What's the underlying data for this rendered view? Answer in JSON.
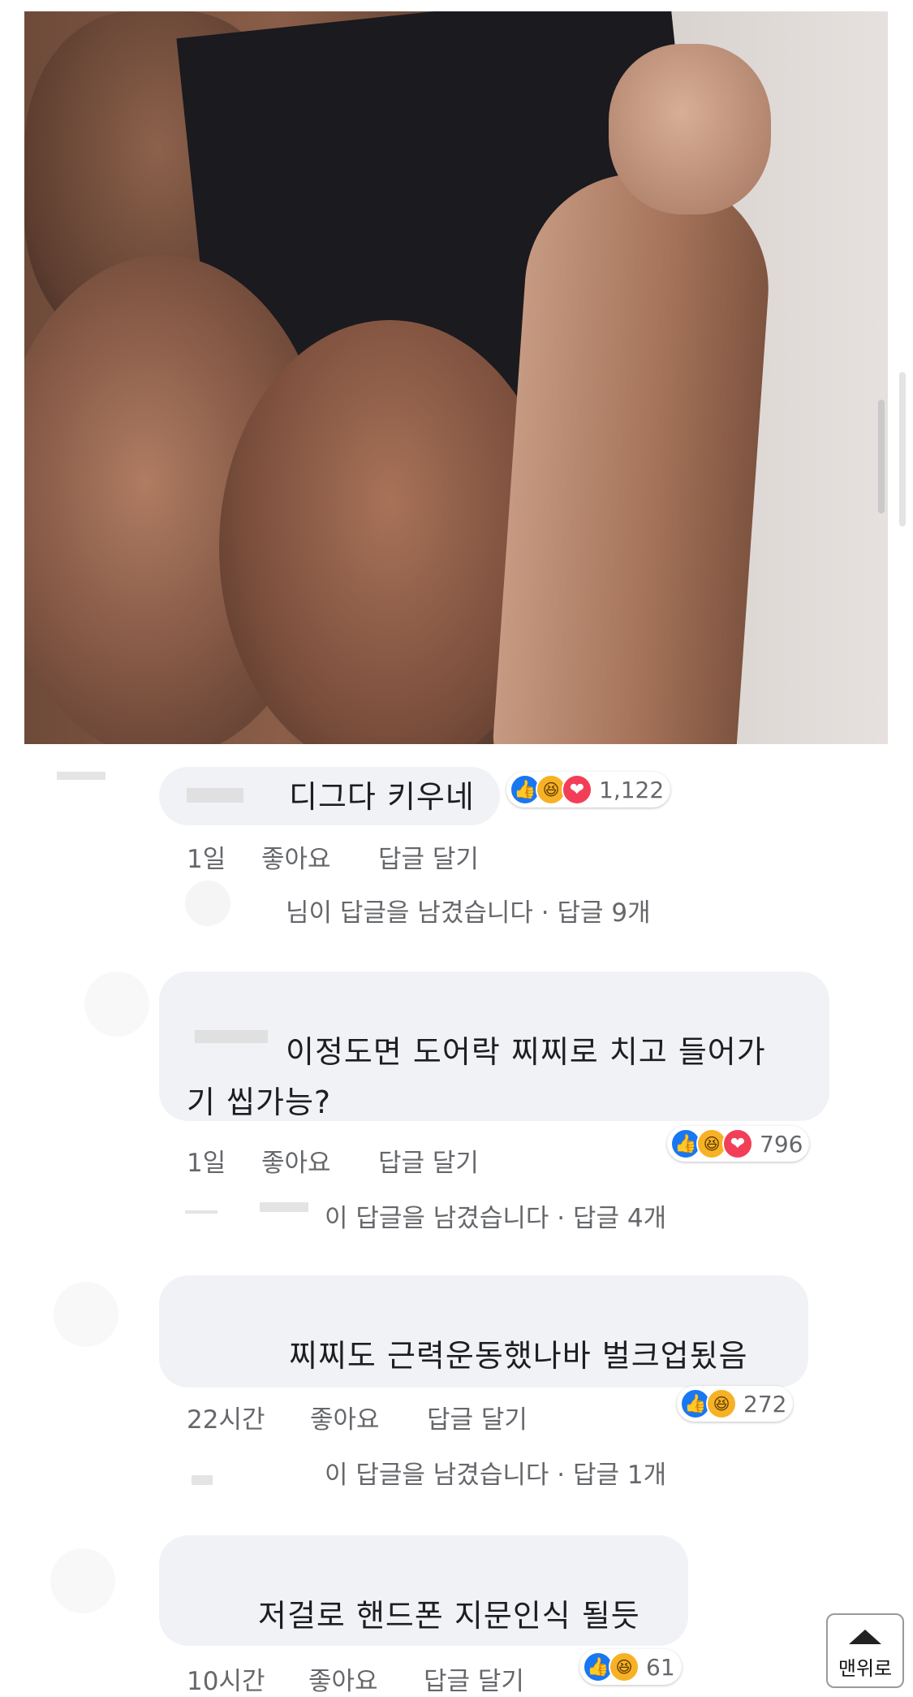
{
  "comments": [
    {
      "text": "디그다 키우네",
      "time": "1일",
      "like": "좋아요",
      "reply": "답글 달기",
      "reactions": [
        "like-icon",
        "haha-icon",
        "love-icon"
      ],
      "reaction_count": "1,122",
      "reply_summary": "님이 답글을 남겼습니다",
      "reply_count": "· 답글 9개"
    },
    {
      "text": "이정도면 도어락 찌찌로 치고 들어가",
      "text2": "기 씹가능?",
      "time": "1일",
      "like": "좋아요",
      "reply": "답글 달기",
      "reactions": [
        "like-icon",
        "haha-icon",
        "love-icon"
      ],
      "reaction_count": "796",
      "reply_summary": "이 답글을 남겼습니다",
      "reply_count": "· 답글 4개"
    },
    {
      "text": "찌찌도 근력운동했나바 벌크업됬음",
      "time": "22시간",
      "like": "좋아요",
      "reply": "답글 달기",
      "reactions": [
        "like-icon",
        "haha-icon"
      ],
      "reaction_count": "272",
      "reply_summary": "이 답글을 남겼습니다",
      "reply_count": "· 답글 1개"
    },
    {
      "text": "저걸로 핸드폰 지문인식 될듯",
      "time": "10시간",
      "like": "좋아요",
      "reply": "답글 달기",
      "reactions": [
        "like-icon",
        "haha-icon"
      ],
      "reaction_count": "61"
    }
  ],
  "scroll_top_button": {
    "label": "맨위로"
  },
  "colors": {
    "like": "#1877f2",
    "haha": "#f7b125",
    "love": "#f33e58",
    "bubble": "#f0f2f5"
  }
}
